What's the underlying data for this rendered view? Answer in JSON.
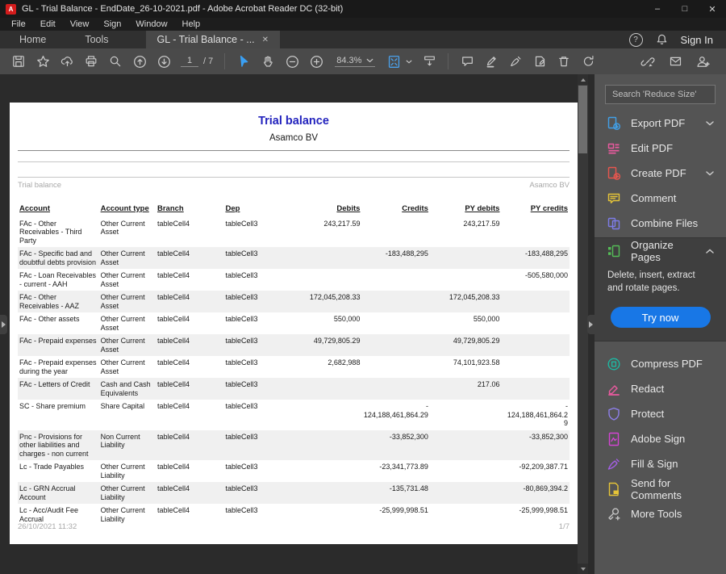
{
  "window": {
    "title": "GL - Trial Balance - EndDate_26-10-2021.pdf - Adobe Acrobat Reader DC (32-bit)",
    "minimize": "–",
    "maximize": "□",
    "close": "✕",
    "app_badge": "A"
  },
  "menu": {
    "items": [
      "File",
      "Edit",
      "View",
      "Sign",
      "Window",
      "Help"
    ]
  },
  "tabbar": {
    "home": "Home",
    "tools": "Tools",
    "document_tab": "GL - Trial Balance - ...",
    "close_tab": "✕",
    "help": "?",
    "sign_in": "Sign In"
  },
  "toolbar": {
    "page_current": "1",
    "page_total": "/ 7",
    "zoom_value": "84.3%",
    "icons": [
      "save",
      "star",
      "share-cloud",
      "print",
      "find",
      "previous-page",
      "next-page",
      "select-tool",
      "hand-tool",
      "zoom-out",
      "zoom-in",
      "page-fit",
      "page-scroll",
      "comment",
      "highlight",
      "fill-sign",
      "stamp",
      "delete",
      "redo",
      "link",
      "email",
      "add-account"
    ]
  },
  "sidebar": {
    "search_placeholder": "Search 'Reduce Size'",
    "accent_blue": "#1877e6",
    "items_top": [
      {
        "label": "Export PDF",
        "color": "#41a0e8",
        "chevron": "down"
      },
      {
        "label": "Edit PDF",
        "color": "#ea5a9f",
        "chevron": ""
      },
      {
        "label": "Create PDF",
        "color": "#e8564e",
        "chevron": "down"
      },
      {
        "label": "Comment",
        "color": "#e5c438",
        "chevron": ""
      },
      {
        "label": "Combine Files",
        "color": "#7d7ce8",
        "chevron": ""
      },
      {
        "label": "Organize Pages",
        "color": "#55bd57",
        "chevron": "up"
      }
    ],
    "organize_panel": {
      "description": "Delete, insert, extract and rotate pages.",
      "button_label": "Try now"
    },
    "items_bottom": [
      {
        "label": "Compress PDF",
        "color": "#1db8a2"
      },
      {
        "label": "Redact",
        "color": "#ea5a9f"
      },
      {
        "label": "Protect",
        "color": "#8d7fe8"
      },
      {
        "label": "Adobe Sign",
        "color": "#d344d3"
      },
      {
        "label": "Fill & Sign",
        "color": "#a55fe8"
      },
      {
        "label": "Send for Comments",
        "color": "#e5c438"
      },
      {
        "label": "More Tools",
        "color": "#c2c2c2"
      }
    ]
  },
  "document": {
    "title": "Trial balance",
    "title_color": "#2323bd",
    "subtitle": "Asamco BV",
    "meta_left": "Trial balance",
    "meta_right": "Asamco BV",
    "footer_left": "26/10/2021 11:32",
    "footer_right": "1/7",
    "table": {
      "headers": [
        "Account",
        "Account type",
        "Branch",
        "Dep",
        "Debits",
        "Credits",
        "PY debits",
        "PY credits"
      ],
      "rows": [
        [
          "FAc - Other Receivables - Third Party",
          "Other Current Asset",
          "tableCell4",
          "tableCell3",
          "243,217.59",
          "",
          "243,217.59",
          ""
        ],
        [
          "FAc - Specific bad and doubtful debts provision",
          "Other Current Asset",
          "tableCell4",
          "tableCell3",
          "",
          "-183,488,295",
          "",
          "-183,488,295"
        ],
        [
          "FAc - Loan Receivables - current - AAH",
          "Other Current Asset",
          "tableCell4",
          "tableCell3",
          "",
          "",
          "",
          "-505,580,000"
        ],
        [
          "FAc - Other Receivables - AAZ",
          "Other Current Asset",
          "tableCell4",
          "tableCell3",
          "172,045,208.33",
          "",
          "172,045,208.33",
          ""
        ],
        [
          "FAc - Other assets",
          "Other Current Asset",
          "tableCell4",
          "tableCell3",
          "550,000",
          "",
          "550,000",
          ""
        ],
        [
          "FAc - Prepaid expenses",
          "Other Current Asset",
          "tableCell4",
          "tableCell3",
          "49,729,805.29",
          "",
          "49,729,805.29",
          ""
        ],
        [
          "FAc - Prepaid expenses during the year",
          "Other Current Asset",
          "tableCell4",
          "tableCell3",
          "2,682,988",
          "",
          "74,101,923.58",
          ""
        ],
        [
          "FAc - Letters of Credit",
          "Cash and Cash Equivalents",
          "tableCell4",
          "tableCell3",
          "",
          "",
          "217.06",
          ""
        ],
        [
          "SC - Share premium",
          "Share Capital",
          "tableCell4",
          "tableCell3",
          "",
          "-\n124,188,461,864.29",
          "",
          "-\n124,188,461,864.2\n9"
        ],
        [
          "Pnc - Provisions for other liabilities and charges - non current",
          "Non Current Liability",
          "tableCell4",
          "tableCell3",
          "",
          "-33,852,300",
          "",
          "-33,852,300"
        ],
        [
          "Lc - Trade Payables",
          "Other Current Liability",
          "tableCell4",
          "tableCell3",
          "",
          "-23,341,773.89",
          "",
          "-92,209,387.71"
        ],
        [
          "Lc - GRN Accrual Account",
          "Other Current Liability",
          "tableCell4",
          "tableCell3",
          "",
          "-135,731.48",
          "",
          "-80,869,394.2"
        ],
        [
          "Lc - Acc/Audit Fee Accrual",
          "Other Current Liability",
          "tableCell4",
          "tableCell3",
          "",
          "-25,999,998.51",
          "",
          "-25,999,998.51"
        ]
      ]
    }
  }
}
